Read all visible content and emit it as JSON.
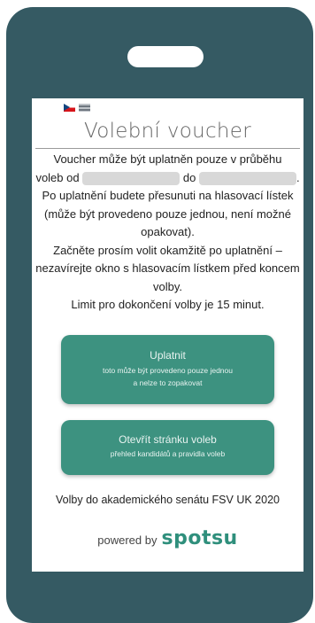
{
  "languages": [
    {
      "code": "cs",
      "icon": "czech-flag-icon"
    },
    {
      "code": "en",
      "icon": "uk-flag-icon"
    }
  ],
  "page": {
    "title": "Volební voucher"
  },
  "body": {
    "line1a": "Voucher může být uplatněn pouze v průběhu",
    "line1b": "voleb od",
    "line1c": "do",
    "line1d": ".",
    "para2": "Po uplatnění budete přesunuti na hlasovací lístek (může být provedeno pouze jednou, není možné opakovat).",
    "para3": "Začněte prosím volit okamžitě po uplatnění – nezavírejte okno s hlasovacím lístkem před koncem volby.",
    "para4": "Limit pro dokončení volby je 15 minut."
  },
  "buttons": {
    "redeem_label": "Uplatnit",
    "redeem_sub1": "toto může být provedeno pouze jednou",
    "redeem_sub2": "a nelze to zopakovat",
    "open_label": "Otevřít stránku voleb",
    "open_sub": "přehled kandidátů a pravidla voleb"
  },
  "footer": {
    "election_name": "Volby do akademického senátu FSV UK 2020",
    "powered_by": "powered by",
    "brand": "spotsu"
  },
  "colors": {
    "device_frame": "#355a63",
    "button": "#3d9280",
    "brand": "#2f8f7c"
  }
}
